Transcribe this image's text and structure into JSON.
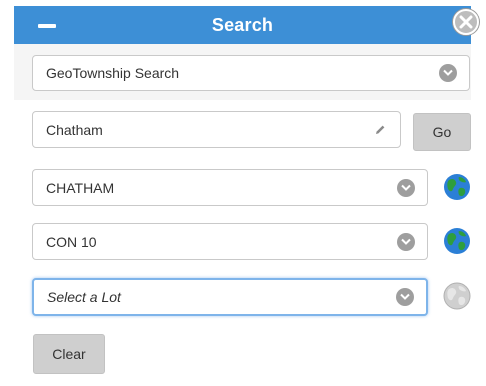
{
  "header": {
    "title": "Search"
  },
  "search_type": {
    "selected": "GeoTownship Search"
  },
  "township_input": {
    "value": "Chatham"
  },
  "go_button": {
    "label": "Go"
  },
  "township_select": {
    "selected": "CHATHAM"
  },
  "concession_select": {
    "selected": "CON 10"
  },
  "lot_select": {
    "placeholder": "Select a Lot"
  },
  "clear_button": {
    "label": "Clear"
  },
  "colors": {
    "header_bg": "#3d8fd6",
    "globe_active_ocean": "#2b7fd6",
    "globe_active_land": "#2e9e3e",
    "globe_disabled": "#bdbdbd"
  },
  "icons": {
    "collapse": "minus-icon",
    "close": "close-icon",
    "dropdown": "chevron-down-icon",
    "edit": "pencil-icon",
    "zoom": "globe-icon"
  }
}
